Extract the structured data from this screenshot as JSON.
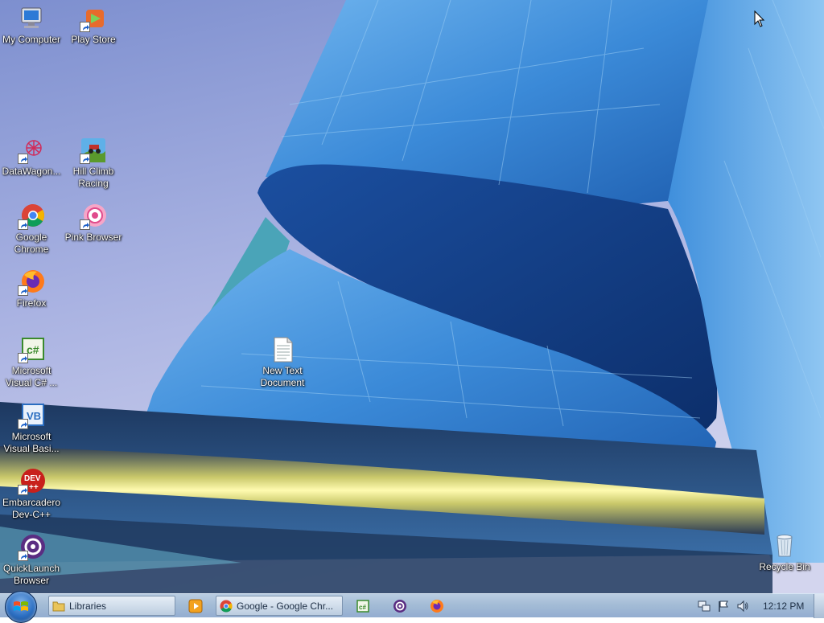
{
  "desktop": {
    "icons": [
      {
        "label": "My Computer",
        "icon": "computer-icon"
      },
      {
        "label": "Play Store",
        "icon": "play-store-icon"
      },
      {
        "label": "DataWagon...",
        "icon": "datawagon-icon"
      },
      {
        "label": "Hill Climb\nRacing",
        "icon": "hill-climb-racing-icon"
      },
      {
        "label": "Google\nChrome",
        "icon": "chrome-icon"
      },
      {
        "label": "Pink Browser",
        "icon": "pink-browser-icon"
      },
      {
        "label": "Firefox",
        "icon": "firefox-icon"
      },
      {
        "label": "Microsoft\nVisual C# ...",
        "icon": "visual-csharp-icon"
      },
      {
        "label": "New Text\nDocument",
        "icon": "text-document-icon"
      },
      {
        "label": "Microsoft\nVisual Basi...",
        "icon": "visual-basic-icon"
      },
      {
        "label": "Embarcadero\nDev-C++",
        "icon": "dev-cpp-icon"
      },
      {
        "label": "QuickLaunch\nBrowser",
        "icon": "quicklaunch-browser-icon"
      },
      {
        "label": "Recycle Bin",
        "icon": "recycle-bin-icon"
      }
    ]
  },
  "taskbar": {
    "start_label": "Start",
    "libraries_label": "Libraries",
    "chrome_window_label": "Google - Google Chr...",
    "clock": "12:12 PM",
    "accent": "#2c6fc2"
  }
}
